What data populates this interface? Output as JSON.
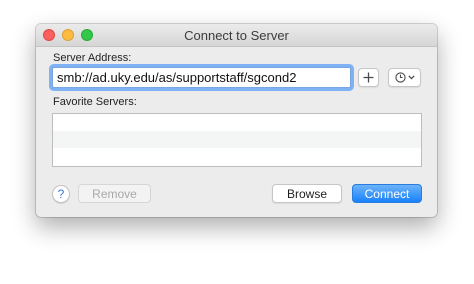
{
  "window": {
    "title": "Connect to Server"
  },
  "form": {
    "server_address_label": "Server Address:",
    "server_address_value": "smb://ad.uky.edu/as/supportstaff/sgcond2",
    "favorite_servers_label": "Favorite Servers:",
    "favorite_servers": []
  },
  "buttons": {
    "add": "+",
    "help": "?",
    "remove": "Remove",
    "browse": "Browse",
    "connect": "Connect"
  },
  "icons": {
    "recent": "clock-icon",
    "dropdown": "chevron-down-icon"
  },
  "colors": {
    "focus_ring": "#7fb1f5",
    "connect_button": "#1a82fb",
    "close": "#fc605c",
    "minimize": "#fdbc40",
    "maximize": "#34c84a"
  }
}
